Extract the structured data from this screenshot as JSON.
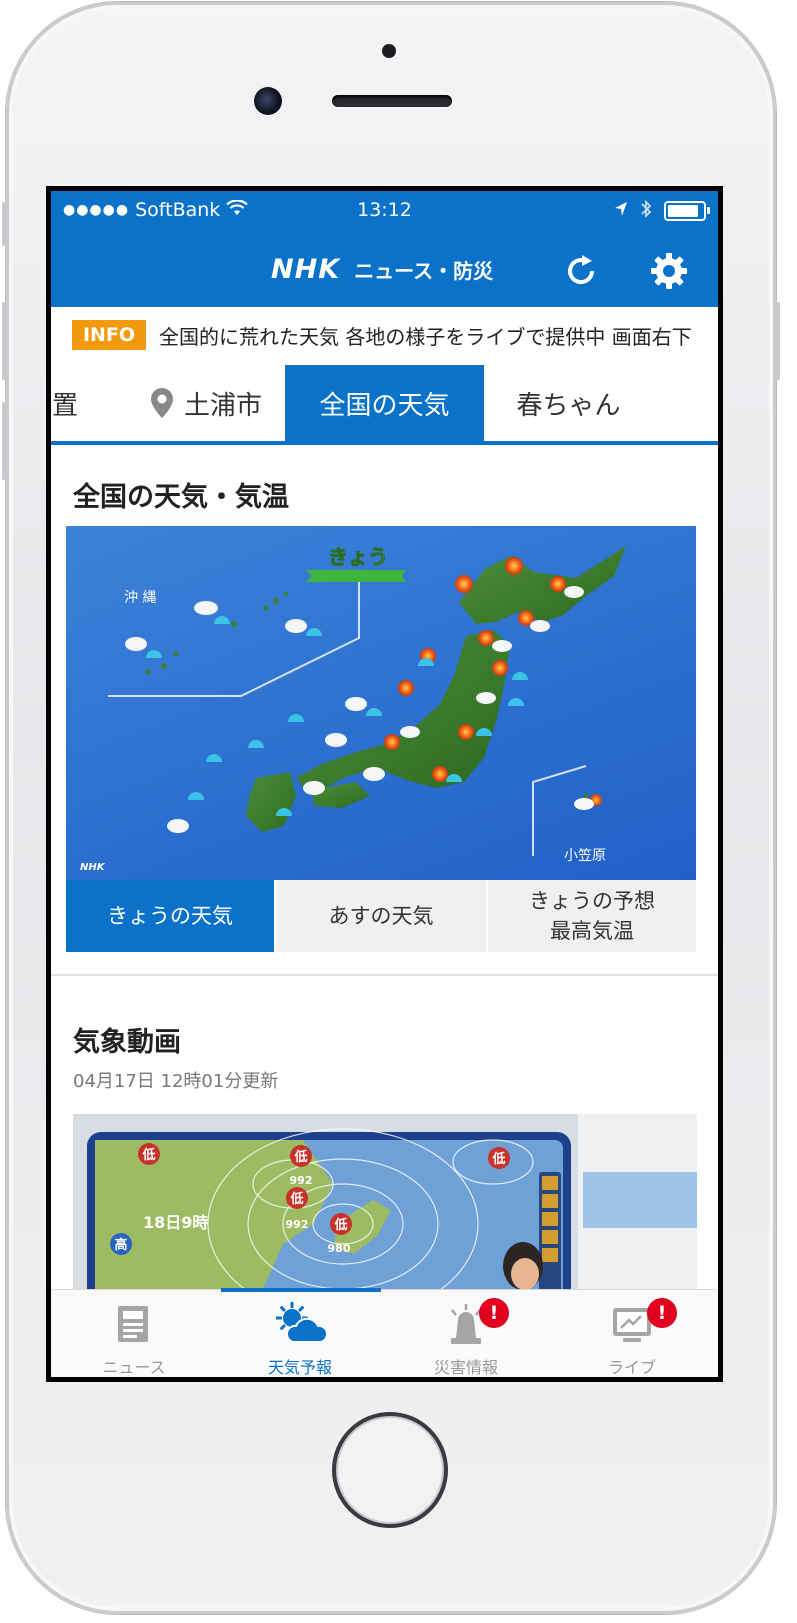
{
  "status_bar": {
    "signal": "●●●●●",
    "carrier": "SoftBank",
    "time": "13:12"
  },
  "header": {
    "logo_main": "NHK",
    "logo_sub": "ニュース・防災"
  },
  "ticker": {
    "badge": "INFO",
    "text": "全国的に荒れた天気 各地の様子をライブで提供中 画面右下"
  },
  "tabs": [
    {
      "label": "置"
    },
    {
      "label": "土浦市"
    },
    {
      "label": "全国の天気",
      "active": true
    },
    {
      "label": "春ちゃん"
    }
  ],
  "weather_section": {
    "title": "全国の天気・気温",
    "map": {
      "day_label": "きょう",
      "okinawa_label": "沖 縄",
      "ogasawara_label": "小笠原",
      "broadcaster_mark": "NHK"
    },
    "subtabs": [
      {
        "label": "きょうの天気",
        "active": true
      },
      {
        "label": "あすの天気"
      },
      {
        "label_line1": "きょうの予想",
        "label_line2": "最高気温"
      }
    ]
  },
  "video_section": {
    "title": "気象動画",
    "updated": "04月17日 12時01分更新",
    "thumbnail": {
      "time_label": "18日9時",
      "lows": [
        {
          "label": "低"
        },
        {
          "label": "低",
          "pressure": "992"
        },
        {
          "label": "低",
          "pressure": "992"
        },
        {
          "label": "低",
          "pressure": "980"
        },
        {
          "label": "低"
        }
      ],
      "high_label": "高"
    }
  },
  "bottom_nav": {
    "items": [
      {
        "label": "ニュース",
        "icon": "news-icon"
      },
      {
        "label": "天気予報",
        "icon": "weather-icon",
        "active": true
      },
      {
        "label": "災害情報",
        "icon": "siren-icon",
        "badge": "!"
      },
      {
        "label": "ライブ",
        "icon": "live-tv-icon",
        "badge": "!"
      }
    ]
  },
  "colors": {
    "brand_blue": "#0a72c8",
    "info_orange": "#f29a0d",
    "alert_red": "#e0001e"
  }
}
